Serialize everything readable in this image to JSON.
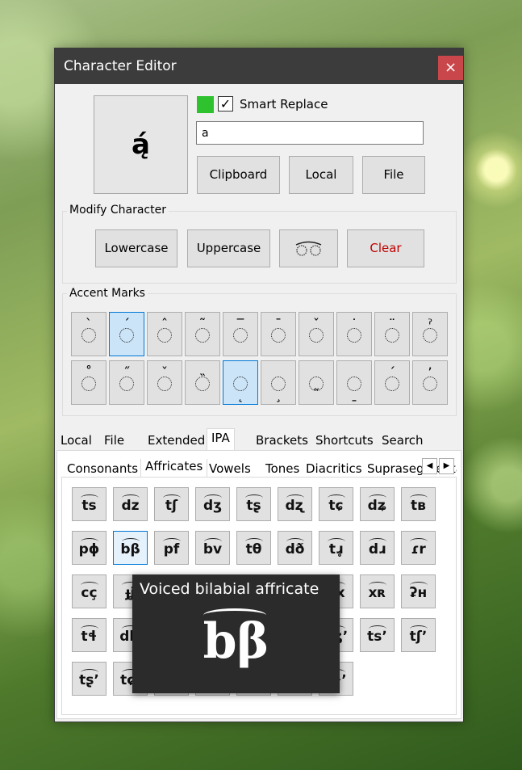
{
  "window": {
    "title": "Character Editor",
    "close": "×"
  },
  "preview": {
    "char": "ą́"
  },
  "smart_replace": {
    "checked": "✓",
    "label": "Smart Replace"
  },
  "search": {
    "value": "a"
  },
  "source_buttons": [
    "Clipboard",
    "Local",
    "File"
  ],
  "modify": {
    "label": "Modify Character",
    "lowercase": "Lowercase",
    "uppercase": "Uppercase",
    "spectacles_icon": "glasses-icon",
    "clear": "Clear",
    "clear_color": "#c00000"
  },
  "accents": {
    "label": "Accent Marks",
    "row1": [
      "grave",
      "acute",
      "circumflex",
      "tilde",
      "macron",
      "overline",
      "caron",
      "dot-above",
      "diaeresis",
      "hook-above"
    ],
    "row2": [
      "ring-above",
      "double-acute",
      "caron-small",
      "double-grave",
      "ogonek-under",
      "cedilla",
      "tilde-below",
      "macron-below",
      "acute-right",
      "comma-above-right"
    ],
    "selected_row1": "acute",
    "selected_row2": "ogonek-under"
  },
  "main_tabs": [
    "Local",
    "File",
    "Extended",
    "IPA",
    "Brackets",
    "Shortcuts",
    "Search"
  ],
  "main_tab_active": "IPA",
  "sub_tabs": [
    "Consonants",
    "Affricates",
    "Vowels",
    "Tones",
    "Diacritics",
    "Suprasegmentals"
  ],
  "sub_tab_active": "Affricates",
  "sub_tab_arrows": [
    "◀",
    "▶"
  ],
  "affricates": [
    [
      "ts",
      "dz",
      "tʃ",
      "dʒ",
      "tʂ",
      "dʐ",
      "tɕ",
      "dʑ",
      "tʙ"
    ],
    [
      "pɸ",
      "bβ",
      "pf",
      "bv",
      "tθ",
      "dð",
      "tɹ̥",
      "dɹ",
      "ɾr"
    ],
    [
      "cç",
      "ɟʝ",
      "",
      "",
      "",
      "",
      "kx",
      "xʀ",
      "ʡʜ"
    ],
    [
      "tɬ",
      "dɮ",
      "",
      "",
      "",
      "",
      "dʒʼ",
      "tsʼ",
      "tʃʼ"
    ],
    [
      "tʂʼ",
      "tɕʼ",
      "",
      "",
      "",
      "",
      "tɬʼ"
    ]
  ],
  "selected_affricate": "bβ",
  "tooltip": {
    "title": "Voiced bilabial affricate",
    "symbol": "bβ"
  },
  "colors": {
    "titlebar": "#3c3c3c",
    "close": "#c9474b",
    "swatch": "#2fc22f",
    "selection": "#0078d7"
  }
}
